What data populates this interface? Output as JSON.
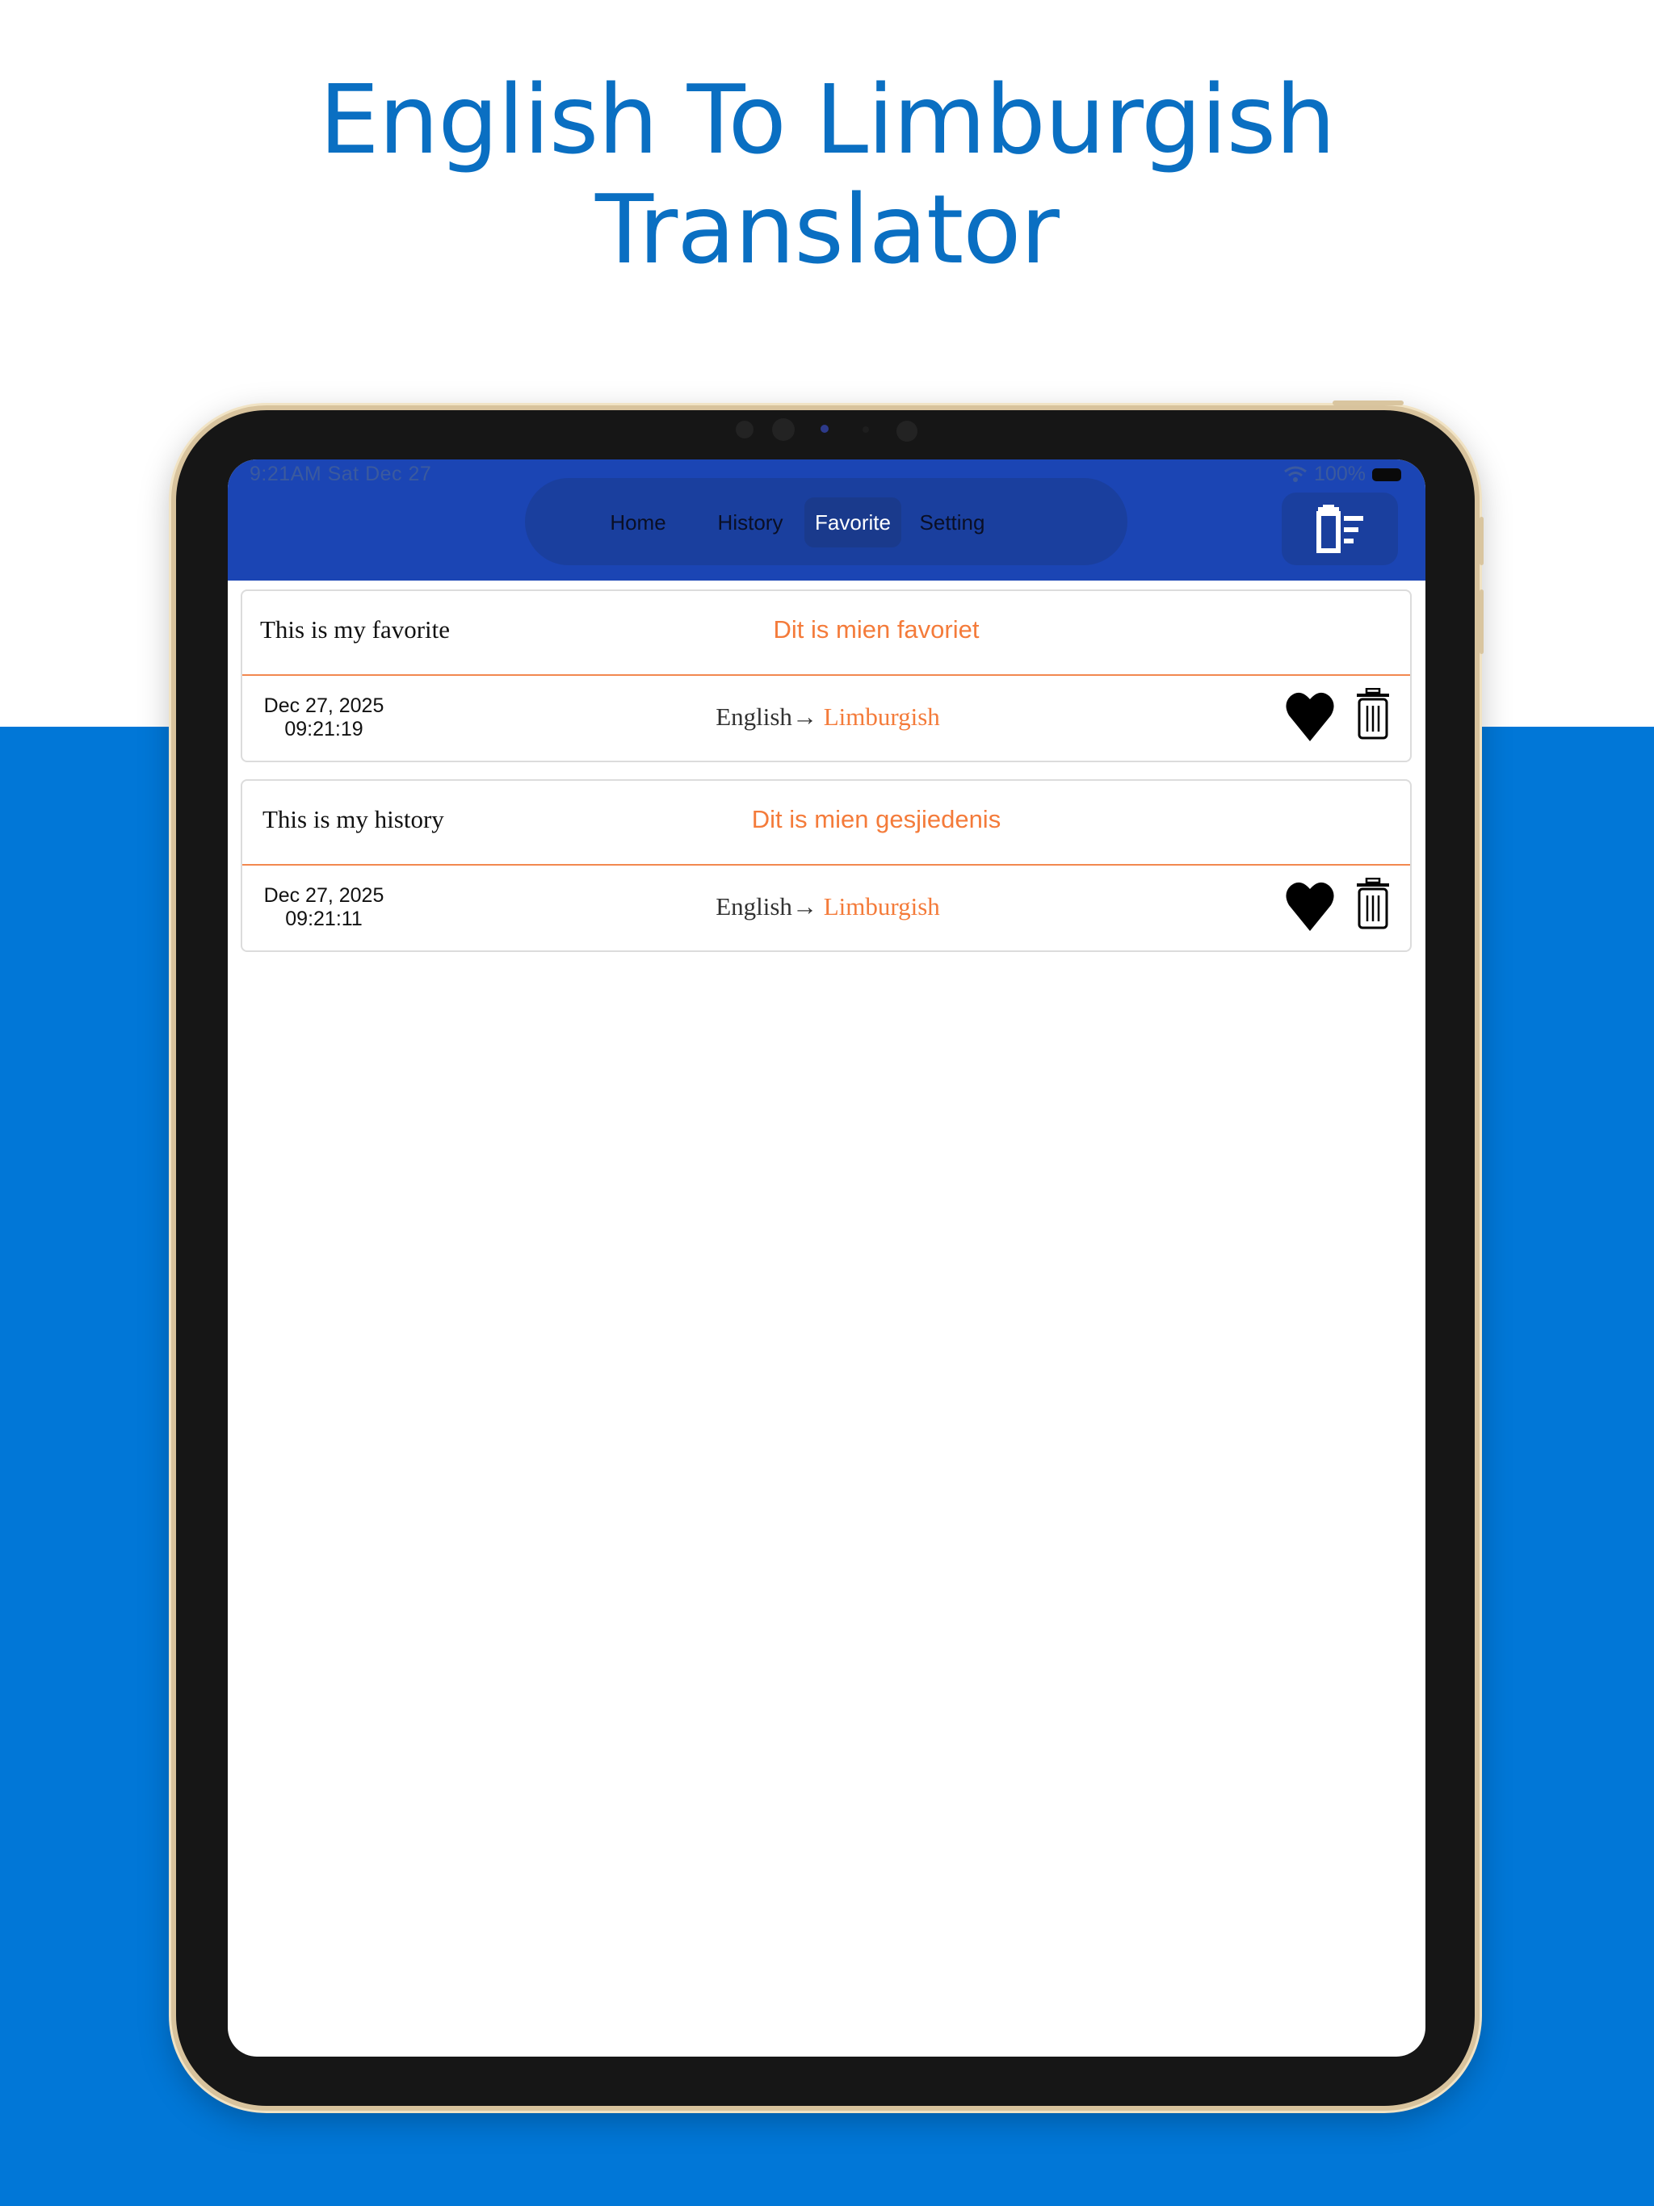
{
  "headline": {
    "line1": "English To Limburgish",
    "line2": "Translator"
  },
  "status_bar": {
    "time": "9:21AM  Sat Dec 27",
    "battery": "100%"
  },
  "nav": {
    "tabs": [
      {
        "label": "Home",
        "active": false
      },
      {
        "label": "History",
        "active": false
      },
      {
        "label": "Favorite",
        "active": true
      },
      {
        "label": "Setting",
        "active": false
      }
    ],
    "clear_icon": "clear-all-icon"
  },
  "entries": [
    {
      "source_text": "This is my favorite",
      "translated_text": "Dit is mien favoriet",
      "date": "Dec 27, 2025",
      "time": "09:21:19",
      "from_lang": "English",
      "arrow": "→",
      "to_lang": "Limburgish"
    },
    {
      "source_text": "This is my history",
      "translated_text": "Dit is mien gesjiedenis",
      "date": "Dec 27, 2025",
      "time": "09:21:11",
      "from_lang": "English",
      "arrow": "→",
      "to_lang": "Limburgish"
    }
  ],
  "colors": {
    "nav_bar": "#1b45b4",
    "accent_orange": "#f47b3a",
    "promo_blue": "#0177d7",
    "headline_blue": "#0a6fc2"
  }
}
